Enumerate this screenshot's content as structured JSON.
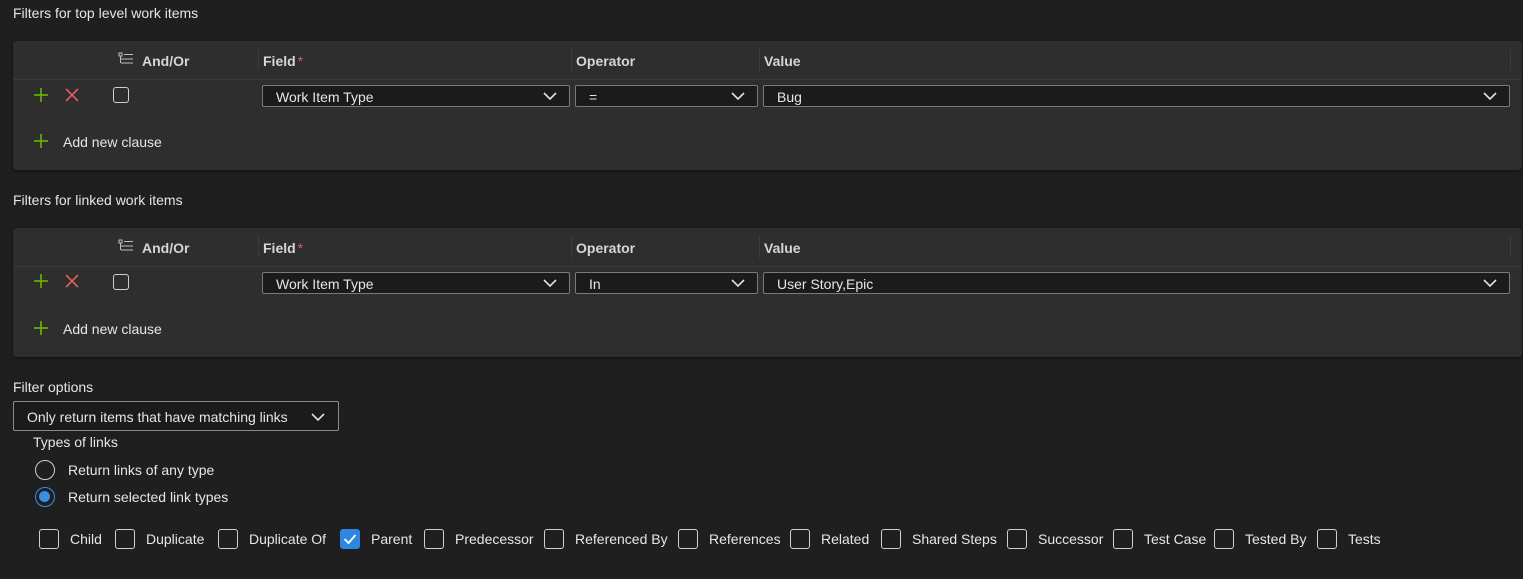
{
  "sections": {
    "top_title": "Filters for top level work items",
    "linked_title": "Filters for linked work items",
    "filter_options_title": "Filter options"
  },
  "columns": {
    "andor": "And/Or",
    "field": "Field",
    "required_mark": "*",
    "operator": "Operator",
    "value": "Value"
  },
  "top_clause": {
    "field": "Work Item Type",
    "operator": "=",
    "value": "Bug"
  },
  "linked_clause": {
    "field": "Work Item Type",
    "operator": "In",
    "value": "User Story,Epic"
  },
  "add_new_clause": "Add new clause",
  "filter_option_selected": "Only return items that have matching links",
  "types_of_links": {
    "title": "Types of links",
    "any": "Return links of any type",
    "selected": "Return selected link types",
    "selected_choice": "selected"
  },
  "link_types": [
    {
      "label": "Child",
      "checked": false
    },
    {
      "label": "Duplicate",
      "checked": false
    },
    {
      "label": "Duplicate Of",
      "checked": false
    },
    {
      "label": "Parent",
      "checked": true
    },
    {
      "label": "Predecessor",
      "checked": false
    },
    {
      "label": "Referenced By",
      "checked": false
    },
    {
      "label": "References",
      "checked": false
    },
    {
      "label": "Related",
      "checked": false
    },
    {
      "label": "Shared Steps",
      "checked": false
    },
    {
      "label": "Successor",
      "checked": false
    },
    {
      "label": "Test Case",
      "checked": false
    },
    {
      "label": "Tested By",
      "checked": false
    },
    {
      "label": "Tests",
      "checked": false
    }
  ],
  "colors": {
    "background": "#1f1f1f",
    "panel": "#2e2e2e",
    "add_green": "#6bb700",
    "delete_red": "#e05b5b",
    "accent_blue": "#2f86e0"
  }
}
